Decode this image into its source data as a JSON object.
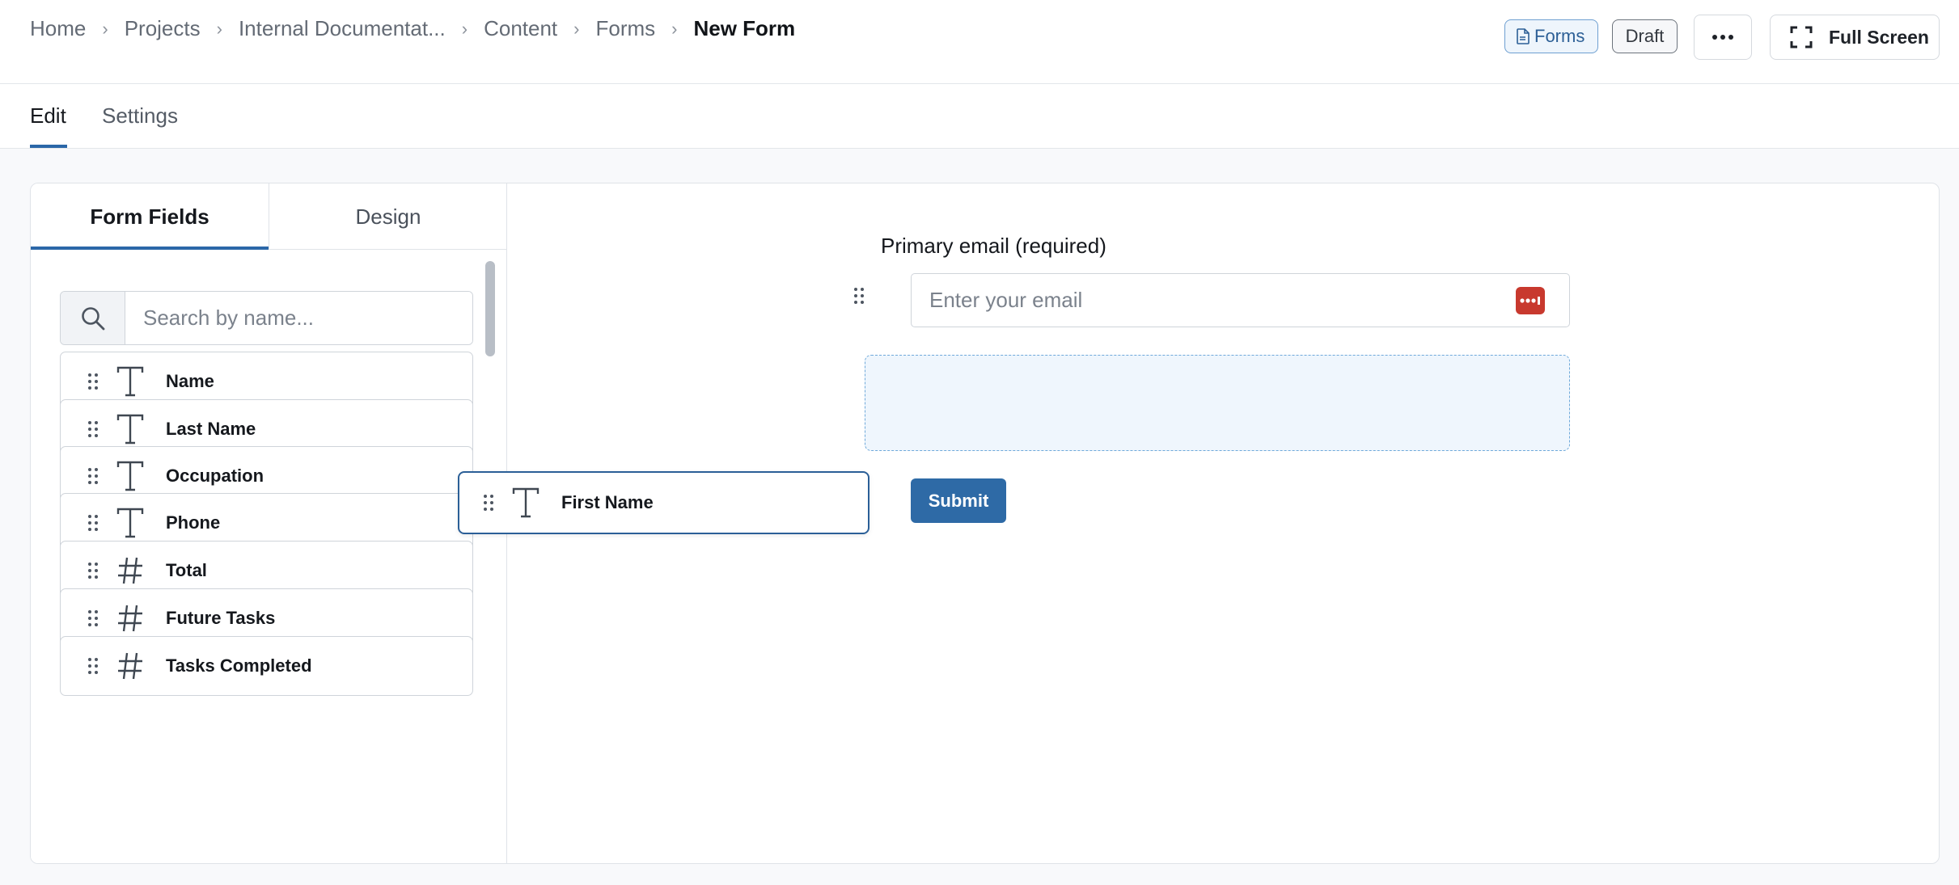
{
  "breadcrumb": {
    "items": [
      "Home",
      "Projects",
      "Internal Documentat...",
      "Content",
      "Forms"
    ],
    "current": "New Form"
  },
  "header": {
    "forms_badge": "Forms",
    "draft_badge": "Draft",
    "full_screen_label": "Full Screen"
  },
  "tabs": {
    "edit": "Edit",
    "settings": "Settings"
  },
  "sidebar": {
    "tab_fields": "Form Fields",
    "tab_design": "Design",
    "search_placeholder": "Search by name...",
    "fields": [
      {
        "label": "Name",
        "type": "text"
      },
      {
        "label": "Last Name",
        "type": "text"
      },
      {
        "label": "Occupation",
        "type": "text"
      },
      {
        "label": "Phone",
        "type": "text"
      },
      {
        "label": "Total",
        "type": "number"
      },
      {
        "label": "Future Tasks",
        "type": "number"
      },
      {
        "label": "Tasks Completed",
        "type": "number"
      }
    ]
  },
  "canvas": {
    "email_label": "Primary email",
    "email_required": "(required)",
    "email_placeholder": "Enter your email",
    "submit_label": "Submit",
    "dragging_field": {
      "label": "First Name",
      "type": "text"
    }
  },
  "colors": {
    "accent": "#2b67a8",
    "submit": "#2e6aa6",
    "dropzone": "#eff6fd",
    "password_icon": "#c8392e"
  }
}
